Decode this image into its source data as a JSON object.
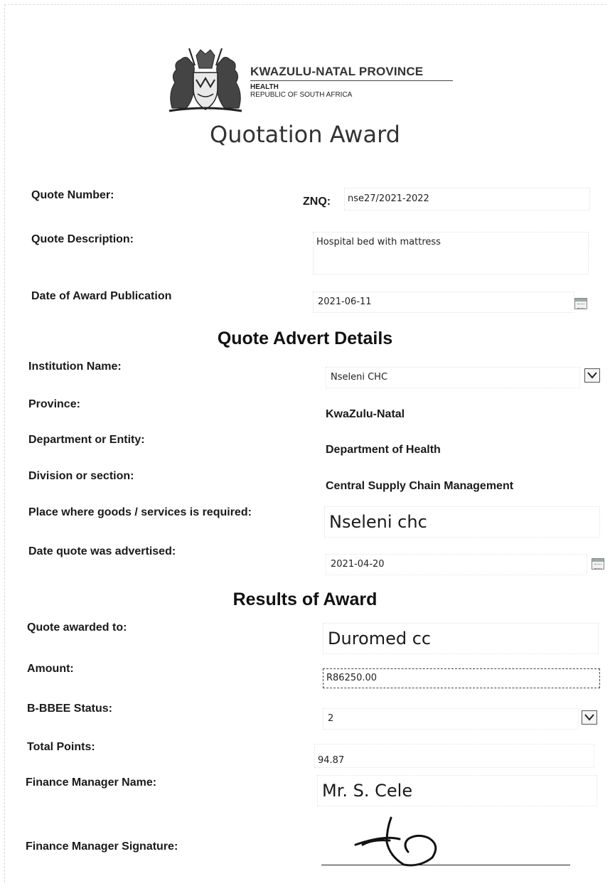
{
  "header": {
    "province_title": "KWAZULU-NATAL PROVINCE",
    "department": "HEALTH",
    "country": "REPUBLIC OF SOUTH AFRICA",
    "logo_icon": "coat-of-arms-icon"
  },
  "page_title": "Quotation Award",
  "quote": {
    "number_label": "Quote Number:",
    "number_prefix": "ZNQ:",
    "number_value": "nse27/2021-2022",
    "description_label": "Quote Description:",
    "description_value": "Hospital bed with mattress",
    "award_date_label": "Date of Award Publication",
    "award_date_value": "2021-06-11"
  },
  "advert": {
    "title": "Quote Advert Details",
    "institution_label": "Institution Name:",
    "institution_value": "Nseleni CHC",
    "province_label": "Province:",
    "province_value": "KwaZulu-Natal",
    "department_label": "Department or Entity:",
    "department_value": "Department of Health",
    "division_label": "Division or section:",
    "division_value": "Central Supply Chain Management",
    "place_label": "Place where goods /  services is required:",
    "place_value": "Nseleni chc",
    "advertised_label": "Date quote was advertised:",
    "advertised_value": "2021-04-20"
  },
  "results": {
    "title": "Results of Award",
    "awarded_label": "Quote awarded to:",
    "awarded_value": "Duromed cc",
    "amount_label": "Amount:",
    "amount_value": "R86250.00",
    "bbbee_label": "B-BBEE Status:",
    "bbbee_value": "2",
    "points_label": "Total Points:",
    "points_value": "94.87",
    "manager_label": "Finance Manager Name:",
    "manager_value": "Mr. S. Cele",
    "signature_label": "Finance Manager Signature:"
  }
}
